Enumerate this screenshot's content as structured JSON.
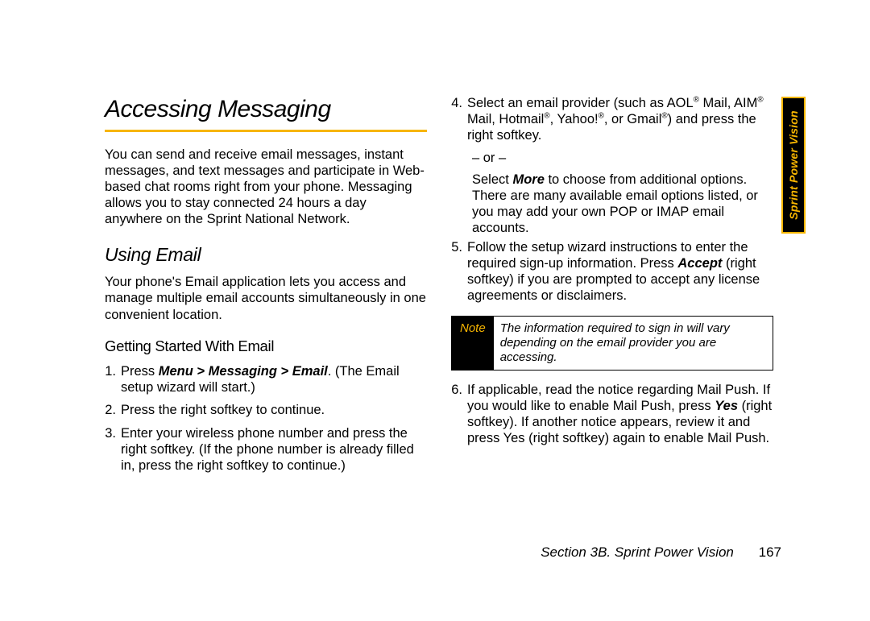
{
  "h1": "Accessing Messaging",
  "intro": "You can send and receive email messages, instant messages, and text messages and participate in Web-based chat rooms right from your phone. Messaging allows you to stay connected 24 hours a day anywhere on the Sprint National Network.",
  "h2": "Using Email",
  "using_intro": "Your phone's Email application lets you access and manage multiple email accounts simultaneously in one convenient location.",
  "h3": "Getting Started With Email",
  "steps": {
    "s1_pre": "Press ",
    "s1_cmd": "Menu > Messaging > Email",
    "s1_post": ". (The Email setup wizard will start.)",
    "s2": "Press the right softkey to continue.",
    "s3": "Enter your wireless phone number and press the right softkey. (If the phone number is already filled in, press the right softkey to continue.)",
    "s4_a": "Select an email provider (such as AOL",
    "s4_b": " Mail, AIM",
    "s4_c": " Mail, Hotmail",
    "s4_d": ", Yahoo!",
    "s4_e": ", or Gmail",
    "s4_f": ") and press the right softkey.",
    "or": "– or –",
    "s4_alt_pre": "Select ",
    "s4_alt_bold": "More",
    "s4_alt_post": " to choose from additional options. There are many available email options listed, or you may add your own POP or IMAP email accounts.",
    "s5_a": "Follow the setup wizard instructions to enter the required sign-up information. Press ",
    "s5_bold": "Accept",
    "s5_b": " (right softkey) if you are prompted to accept any license agreements or disclaimers.",
    "s6_a": "If applicable, read the notice regarding Mail Push. If you would like to enable Mail Push, press ",
    "s6_bold": "Yes",
    "s6_b": " (right softkey). If another notice appears, review it and press Yes (right softkey) again to enable Mail Push."
  },
  "note_label": "Note",
  "note_text": "The information required to sign in will vary depending on the email provider you are accessing.",
  "footer_section": "Section 3B. Sprint Power Vision",
  "footer_page": "167",
  "side_tab": "Sprint Power Vision",
  "reg": "®"
}
